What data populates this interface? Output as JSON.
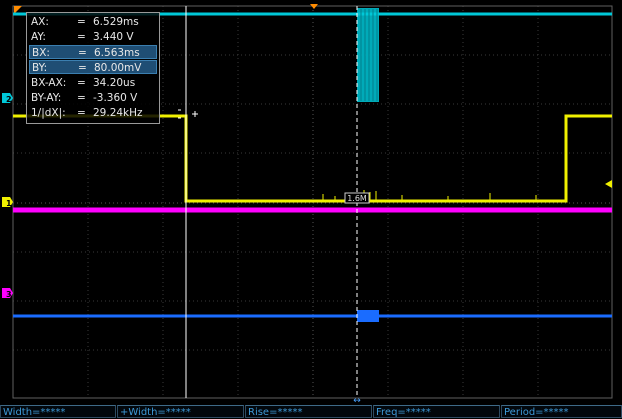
{
  "readout": {
    "rows": [
      {
        "key": "AX:",
        "eq": "=",
        "val": "6.529ms"
      },
      {
        "key": "AY:",
        "eq": "=",
        "val": "3.440 V"
      },
      {
        "key": "BX:",
        "eq": "=",
        "val": "6.563ms"
      },
      {
        "key": "BY:",
        "eq": "=",
        "val": "80.00mV"
      },
      {
        "key": "BX-AX:",
        "eq": "=",
        "val": "34.20us"
      },
      {
        "key": "BY-AY:",
        "eq": "=",
        "val": "-3.360 V"
      },
      {
        "key": "1/|dX|:",
        "eq": "=",
        "val": "29.24kHz"
      }
    ]
  },
  "channels": [
    {
      "label": "2",
      "color": "#00c8d8"
    },
    {
      "label": "1",
      "color": "#f0f000"
    },
    {
      "label": "3",
      "color": "#ff00ff"
    }
  ],
  "cursor_tag": "1.6M",
  "measure_bar": [
    {
      "label": "Width=*****"
    },
    {
      "label": "+Width=*****"
    },
    {
      "label": "Rise=*****"
    },
    {
      "label": "Freq=*****"
    },
    {
      "label": "Period=*****"
    }
  ],
  "colors": {
    "ch1": "#f0f000",
    "ch2": "#00c8d8",
    "ch3": "#ff00ff",
    "ch4": "#1a6cff",
    "grid": "#3a3a3a",
    "trigger": "#ff8c00",
    "cursor": "#ffffff"
  }
}
